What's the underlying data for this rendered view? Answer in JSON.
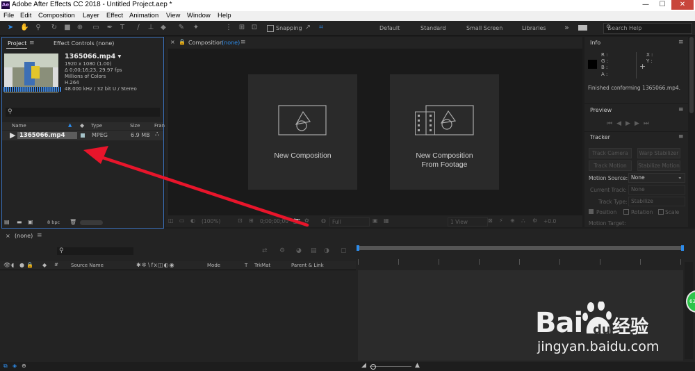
{
  "app": {
    "title": "Adobe After Effects CC 2018 - Untitled Project.aep *",
    "logo_text": "Ae",
    "window_buttons": [
      "—",
      "☐",
      "✕"
    ]
  },
  "menu": [
    "File",
    "Edit",
    "Composition",
    "Layer",
    "Effect",
    "Animation",
    "View",
    "Window",
    "Help"
  ],
  "toolbar": {
    "snapping_label": "Snapping",
    "workspaces": [
      "Default",
      "Standard",
      "Small Screen",
      "Libraries"
    ],
    "overflow": "»",
    "search_placeholder": "Search Help"
  },
  "project": {
    "tab_project": "Project",
    "tab_effect_controls": "Effect Controls (none)",
    "file_name": "1365066.mp4 ▾",
    "meta": [
      "1920 x 1080 (1.00)",
      "Δ 0;00;16;23, 29.97 fps",
      "Millions of Colors",
      "H.264",
      "48.000 kHz / 32 bit U / Stereo"
    ],
    "columns": {
      "name": "Name",
      "type": "Type",
      "size": "Size",
      "frame": "Fran"
    },
    "item": {
      "name": "1365066.mp4",
      "type": "MPEG",
      "size": "6.9 MB"
    },
    "bpc": "8 bpc"
  },
  "composition": {
    "tab_label": "Composition",
    "tab_value": "(none)",
    "new_comp": "New Composition",
    "new_comp_footage_1": "New Composition",
    "new_comp_footage_2": "From Footage",
    "zoom": "(100%)",
    "timecode": "0;00;00;00",
    "resolution": "Full",
    "views": "1 View",
    "exposure": "+0.0"
  },
  "info": {
    "title": "Info",
    "channels": [
      "R :",
      "G :",
      "B :",
      "A :"
    ],
    "coords": [
      "X :",
      "Y :"
    ],
    "message": "Finished conforming 1365066.mp4."
  },
  "preview": {
    "title": "Preview"
  },
  "tracker": {
    "title": "Tracker",
    "buttons": [
      "Track Camera",
      "Warp Stabilizer",
      "Track Motion",
      "Stabilize Motion"
    ],
    "motion_source_label": "Motion Source:",
    "motion_source_value": "None",
    "current_track_label": "Current Track:",
    "current_track_value": "None",
    "track_type_label": "Track Type:",
    "track_type_value": "Stabilize",
    "checks": [
      "Position",
      "Rotation",
      "Scale"
    ],
    "motion_target": "Motion Target:"
  },
  "timeline": {
    "tab": "(none)",
    "columns": {
      "source_name": "Source Name",
      "mode": "Mode",
      "t": "T",
      "trkmat": "TrkMat",
      "parent": "Parent & Link"
    },
    "hash": "#"
  },
  "watermark": {
    "brand": "Bai",
    "brand2": "经验",
    "url": "jingyan.baidu.com"
  },
  "colors": {
    "accent": "#2d8ceb",
    "panel": "#232323",
    "arrow": "#e8152b"
  }
}
